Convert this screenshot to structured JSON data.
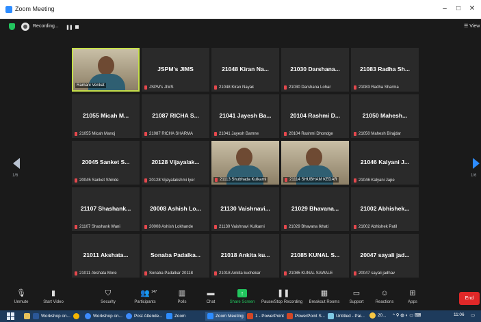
{
  "window": {
    "title": "Zoom Meeting",
    "minimize": "–",
    "maximize": "□",
    "close": "✕"
  },
  "top_bar": {
    "recording_label": "Recording...",
    "pause_icon": "❚❚",
    "view_label": "☰ View"
  },
  "pagination": {
    "left_page": "1/6",
    "right_page": "1/6"
  },
  "tiles": [
    {
      "name": "",
      "label": "Ramani Venkat",
      "video": true,
      "active": true,
      "muted": false
    },
    {
      "name": "JSPM's JIMS",
      "label": "JSPM's JIMS",
      "muted": true
    },
    {
      "name": "21048 Kiran Na...",
      "label": "21048 Kiran Nayak",
      "muted": true
    },
    {
      "name": "21030 Darshana...",
      "label": "21030 Darshana Lohar",
      "muted": true
    },
    {
      "name": "21083 Radha Sh...",
      "label": "21083 Radha Sharma",
      "muted": true
    },
    {
      "name": "21055 Micah M...",
      "label": "21055 Micah Manoj",
      "muted": true
    },
    {
      "name": "21087 RICHA S...",
      "label": "21087 RICHA SHARMA",
      "muted": true
    },
    {
      "name": "21041 Jayesh Ba...",
      "label": "21041 Jayesh Bamne",
      "muted": true
    },
    {
      "name": "20104 Rashmi D...",
      "label": "20104 Rashmi Dhondge",
      "muted": true
    },
    {
      "name": "21050 Mahesh...",
      "label": "21050 Mahesh Birajdar",
      "muted": true
    },
    {
      "name": "20045 Sanket S...",
      "label": "20045 Sanket Shinde",
      "muted": true
    },
    {
      "name": "20128 Vijayalak...",
      "label": "20128 Vijayalakshmi Iyer",
      "muted": true
    },
    {
      "name": "",
      "label": "21113 Shubhada Kulkarni",
      "video": true,
      "muted": true
    },
    {
      "name": "",
      "label": "21114 SHUBHAM KEDAR",
      "video": true,
      "muted": true
    },
    {
      "name": "21046 Kalyani J...",
      "label": "21046 Kalyani Jape",
      "muted": true
    },
    {
      "name": "21107 Shashank...",
      "label": "21107 Shashank Wani",
      "muted": true
    },
    {
      "name": "20008 Ashish Lo...",
      "label": "20008 Ashish Lokhande",
      "muted": true
    },
    {
      "name": "21130 Vaishnavi...",
      "label": "21130 Vaishnavi Kulkarni",
      "muted": true
    },
    {
      "name": "21029 Bhavana...",
      "label": "21029 Bhavana Ikhati",
      "muted": true
    },
    {
      "name": "21002 Abhishek...",
      "label": "21002 Abhishek Patil",
      "muted": true
    },
    {
      "name": "21011 Akshata...",
      "label": "21011 Akshata More",
      "muted": true
    },
    {
      "name": "Sonaba Padalka...",
      "label": "Sonaba Padalkar 20118",
      "muted": true
    },
    {
      "name": "21018 Ankita ku...",
      "label": "21018 Ankita kuchekar",
      "muted": true
    },
    {
      "name": "21085 KUNAL S...",
      "label": "21085 KUNAL SAWALE",
      "muted": true
    },
    {
      "name": "20047 sayali jad...",
      "label": "20047 sayali jadhav",
      "muted": true
    }
  ],
  "toolbar": {
    "unmute": "Unmute",
    "start_video": "Start Video",
    "security": "Security",
    "participants": "Participants",
    "participants_count": "147",
    "polls": "Polls",
    "chat": "Chat",
    "share_screen": "Share Screen",
    "record": "Pause/Stop Recording",
    "breakout": "Breakout Rooms",
    "support": "Support",
    "reactions": "Reactions",
    "apps": "Apps",
    "end": "End"
  },
  "taskbar": {
    "items": [
      "Workshop on...",
      "Workshop on...",
      "Post Attende...",
      "Zoom",
      "Zoom Meeting",
      "1 - PowerPoint",
      "PowerPoint S...",
      "Untitled - Pai..."
    ],
    "tray_temp": "20...",
    "time": "11:06"
  },
  "colors": {
    "accent_blue": "#2d8cff",
    "share_green": "#22c55e",
    "end_red": "#e02828",
    "active_speaker": "#c6e04a",
    "mute_red": "#e5484d"
  }
}
